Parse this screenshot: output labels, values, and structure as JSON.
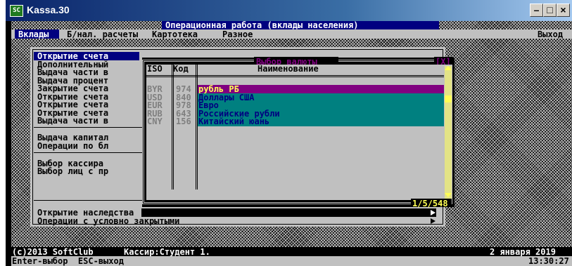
{
  "window": {
    "title": "Kassa.30",
    "icon": "SC"
  },
  "header": {
    "title": "Операционная работа (вклады населения)"
  },
  "menubar": {
    "items": [
      "Вклады",
      "Б/нал. расчеты",
      "Картотека",
      "Разное"
    ],
    "exit": "Выход"
  },
  "menu": {
    "items": [
      "Открытие счета",
      "Дополнительный",
      "Выдача части в",
      "Выдача процент",
      "Закрытие счета",
      "Открытие счета",
      "Открытие счета",
      "Открытие счета",
      "Выдача части в",
      "Выдача капитал",
      "Операции по бл",
      "Выбор кассира",
      "Выбор лиц с пр",
      "Открытие наследства",
      "Операции с условно закрытыми"
    ]
  },
  "dialog": {
    "title": "Выбор валюты",
    "close": "[X]",
    "columns": {
      "iso": "ISO",
      "code": "Код",
      "name": "Наименование"
    },
    "rows": [
      {
        "iso": "BYR",
        "code": "974",
        "name": "рубль РБ"
      },
      {
        "iso": "USD",
        "code": "840",
        "name": "Доллары США"
      },
      {
        "iso": "EUR",
        "code": "978",
        "name": "Евро"
      },
      {
        "iso": "RUB",
        "code": "643",
        "name": "Российские рубли"
      },
      {
        "iso": "CNY",
        "code": "156",
        "name": "Китайский юань"
      }
    ],
    "position": "1/5/548"
  },
  "status": {
    "copyright": "(c)2013 SoftClub",
    "cashier": "Кассир:Студент 1.",
    "date": "2 января 2019",
    "time": "13:30:27",
    "keys": "Enter-выбор  ESC-выход"
  },
  "colors": {
    "selected_row": "#800080",
    "table_rows": "#008080",
    "menu_bg": "#c0c0c0",
    "header": "#000080",
    "highlight_text": "#ffff55"
  }
}
